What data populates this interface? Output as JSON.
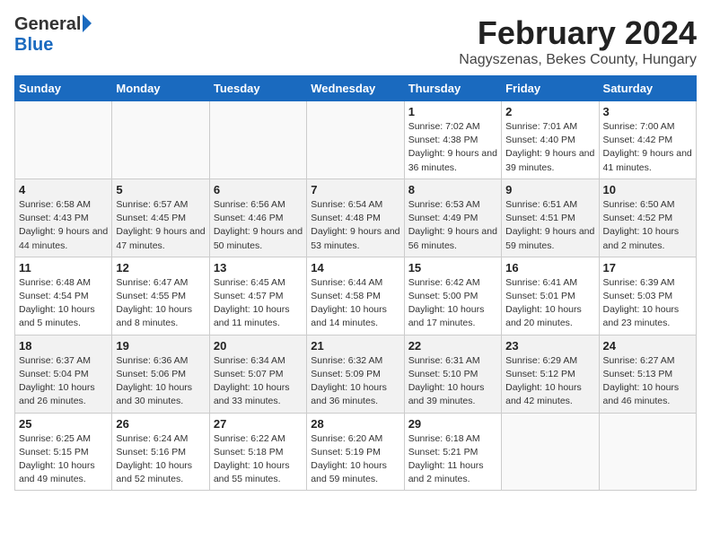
{
  "header": {
    "logo_general": "General",
    "logo_blue": "Blue",
    "main_title": "February 2024",
    "subtitle": "Nagyszenas, Bekes County, Hungary"
  },
  "calendar": {
    "days_of_week": [
      "Sunday",
      "Monday",
      "Tuesday",
      "Wednesday",
      "Thursday",
      "Friday",
      "Saturday"
    ],
    "weeks": [
      [
        {
          "day": null
        },
        {
          "day": null
        },
        {
          "day": null
        },
        {
          "day": null
        },
        {
          "day": "1",
          "info": "Sunrise: 7:02 AM\nSunset: 4:38 PM\nDaylight: 9 hours\nand 36 minutes."
        },
        {
          "day": "2",
          "info": "Sunrise: 7:01 AM\nSunset: 4:40 PM\nDaylight: 9 hours\nand 39 minutes."
        },
        {
          "day": "3",
          "info": "Sunrise: 7:00 AM\nSunset: 4:42 PM\nDaylight: 9 hours\nand 41 minutes."
        }
      ],
      [
        {
          "day": "4",
          "info": "Sunrise: 6:58 AM\nSunset: 4:43 PM\nDaylight: 9 hours\nand 44 minutes."
        },
        {
          "day": "5",
          "info": "Sunrise: 6:57 AM\nSunset: 4:45 PM\nDaylight: 9 hours\nand 47 minutes."
        },
        {
          "day": "6",
          "info": "Sunrise: 6:56 AM\nSunset: 4:46 PM\nDaylight: 9 hours\nand 50 minutes."
        },
        {
          "day": "7",
          "info": "Sunrise: 6:54 AM\nSunset: 4:48 PM\nDaylight: 9 hours\nand 53 minutes."
        },
        {
          "day": "8",
          "info": "Sunrise: 6:53 AM\nSunset: 4:49 PM\nDaylight: 9 hours\nand 56 minutes."
        },
        {
          "day": "9",
          "info": "Sunrise: 6:51 AM\nSunset: 4:51 PM\nDaylight: 9 hours\nand 59 minutes."
        },
        {
          "day": "10",
          "info": "Sunrise: 6:50 AM\nSunset: 4:52 PM\nDaylight: 10 hours\nand 2 minutes."
        }
      ],
      [
        {
          "day": "11",
          "info": "Sunrise: 6:48 AM\nSunset: 4:54 PM\nDaylight: 10 hours\nand 5 minutes."
        },
        {
          "day": "12",
          "info": "Sunrise: 6:47 AM\nSunset: 4:55 PM\nDaylight: 10 hours\nand 8 minutes."
        },
        {
          "day": "13",
          "info": "Sunrise: 6:45 AM\nSunset: 4:57 PM\nDaylight: 10 hours\nand 11 minutes."
        },
        {
          "day": "14",
          "info": "Sunrise: 6:44 AM\nSunset: 4:58 PM\nDaylight: 10 hours\nand 14 minutes."
        },
        {
          "day": "15",
          "info": "Sunrise: 6:42 AM\nSunset: 5:00 PM\nDaylight: 10 hours\nand 17 minutes."
        },
        {
          "day": "16",
          "info": "Sunrise: 6:41 AM\nSunset: 5:01 PM\nDaylight: 10 hours\nand 20 minutes."
        },
        {
          "day": "17",
          "info": "Sunrise: 6:39 AM\nSunset: 5:03 PM\nDaylight: 10 hours\nand 23 minutes."
        }
      ],
      [
        {
          "day": "18",
          "info": "Sunrise: 6:37 AM\nSunset: 5:04 PM\nDaylight: 10 hours\nand 26 minutes."
        },
        {
          "day": "19",
          "info": "Sunrise: 6:36 AM\nSunset: 5:06 PM\nDaylight: 10 hours\nand 30 minutes."
        },
        {
          "day": "20",
          "info": "Sunrise: 6:34 AM\nSunset: 5:07 PM\nDaylight: 10 hours\nand 33 minutes."
        },
        {
          "day": "21",
          "info": "Sunrise: 6:32 AM\nSunset: 5:09 PM\nDaylight: 10 hours\nand 36 minutes."
        },
        {
          "day": "22",
          "info": "Sunrise: 6:31 AM\nSunset: 5:10 PM\nDaylight: 10 hours\nand 39 minutes."
        },
        {
          "day": "23",
          "info": "Sunrise: 6:29 AM\nSunset: 5:12 PM\nDaylight: 10 hours\nand 42 minutes."
        },
        {
          "day": "24",
          "info": "Sunrise: 6:27 AM\nSunset: 5:13 PM\nDaylight: 10 hours\nand 46 minutes."
        }
      ],
      [
        {
          "day": "25",
          "info": "Sunrise: 6:25 AM\nSunset: 5:15 PM\nDaylight: 10 hours\nand 49 minutes."
        },
        {
          "day": "26",
          "info": "Sunrise: 6:24 AM\nSunset: 5:16 PM\nDaylight: 10 hours\nand 52 minutes."
        },
        {
          "day": "27",
          "info": "Sunrise: 6:22 AM\nSunset: 5:18 PM\nDaylight: 10 hours\nand 55 minutes."
        },
        {
          "day": "28",
          "info": "Sunrise: 6:20 AM\nSunset: 5:19 PM\nDaylight: 10 hours\nand 59 minutes."
        },
        {
          "day": "29",
          "info": "Sunrise: 6:18 AM\nSunset: 5:21 PM\nDaylight: 11 hours\nand 2 minutes."
        },
        {
          "day": null
        },
        {
          "day": null
        }
      ]
    ]
  }
}
